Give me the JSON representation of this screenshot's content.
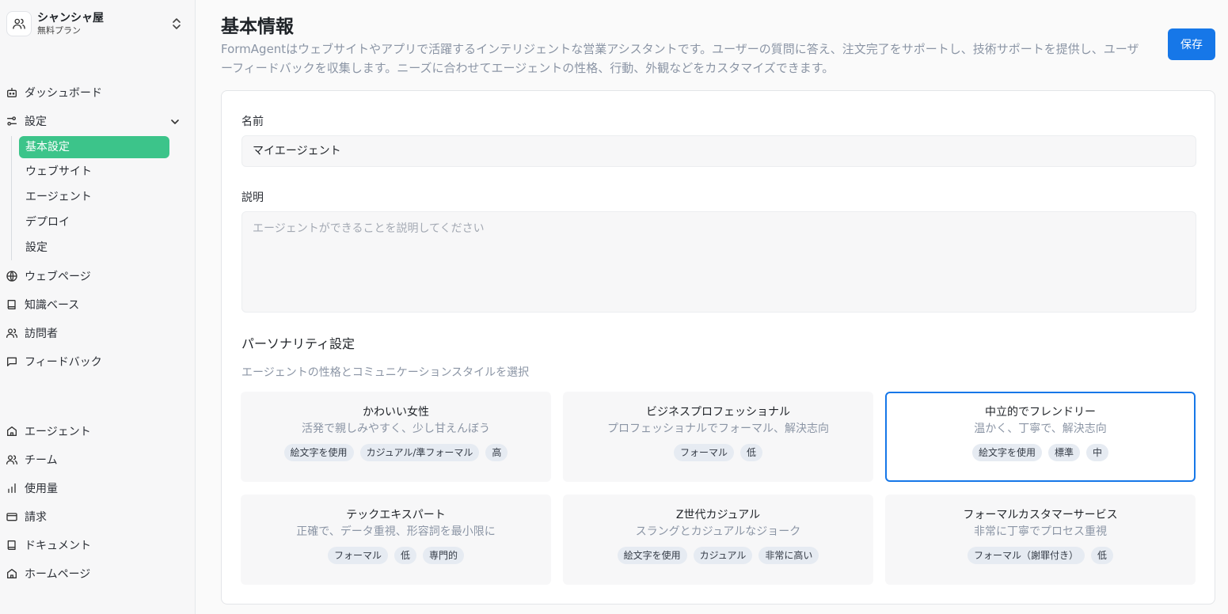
{
  "workspace": {
    "name": "シャンシャ屋",
    "plan": "無料プラン"
  },
  "nav_top": [
    {
      "label": "ダッシュボード",
      "icon": "robot-icon"
    },
    {
      "label": "設定",
      "icon": "settings-sliders-icon"
    }
  ],
  "settings_sub": [
    "基本設定",
    "ウェブサイト",
    "エージェント",
    "デプロイ",
    "設定"
  ],
  "nav_mid": [
    {
      "label": "ウェブページ",
      "icon": "globe-icon"
    },
    {
      "label": "知識ベース",
      "icon": "book-icon"
    },
    {
      "label": "訪問者",
      "icon": "users-icon"
    },
    {
      "label": "フィードバック",
      "icon": "message-square-icon"
    }
  ],
  "nav_bottom": [
    {
      "label": "エージェント",
      "icon": "home-icon"
    },
    {
      "label": "チーム",
      "icon": "users-icon"
    },
    {
      "label": "使用量",
      "icon": "bar-chart-icon"
    },
    {
      "label": "請求",
      "icon": "credit-card-icon"
    },
    {
      "label": "ドキュメント",
      "icon": "book-icon"
    },
    {
      "label": "ホームページ",
      "icon": "home-icon"
    }
  ],
  "header": {
    "title": "基本情報",
    "description": "FormAgentはウェブサイトやアプリで活躍するインテリジェントな営業アシスタントです。ユーザーの質問に答え、注文完了をサポートし、技術サポートを提供し、ユーザーフィードバックを収集します。ニーズに合わせてエージェントの性格、行動、外観などをカスタマイズできます。",
    "save_label": "保存"
  },
  "form": {
    "name_label": "名前",
    "name_value": "マイエージェント",
    "desc_label": "説明",
    "desc_placeholder": "エージェントができることを説明してください",
    "personality_title": "パーソナリティ設定",
    "personality_sub": "エージェントの性格とコミュニケーションスタイルを選択"
  },
  "personas": [
    {
      "title": "かわいい女性",
      "sub": "活発で親しみやすく、少し甘えんぼう",
      "tags": [
        "絵文字を使用",
        "カジュアル/準フォーマル",
        "高"
      ],
      "selected": false
    },
    {
      "title": "ビジネスプロフェッショナル",
      "sub": "プロフェッショナルでフォーマル、解決志向",
      "tags": [
        "フォーマル",
        "低"
      ],
      "selected": false
    },
    {
      "title": "中立的でフレンドリー",
      "sub": "温かく、丁寧で、解決志向",
      "tags": [
        "絵文字を使用",
        "標準",
        "中"
      ],
      "selected": true
    },
    {
      "title": "テックエキスパート",
      "sub": "正確で、データ重視、形容詞を最小限に",
      "tags": [
        "フォーマル",
        "低",
        "専門的"
      ],
      "selected": false
    },
    {
      "title": "Z世代カジュアル",
      "sub": "スラングとカジュアルなジョーク",
      "tags": [
        "絵文字を使用",
        "カジュアル",
        "非常に高い"
      ],
      "selected": false
    },
    {
      "title": "フォーマルカスタマーサービス",
      "sub": "非常に丁寧でプロセス重視",
      "tags": [
        "フォーマル（謝罪付き）",
        "低"
      ],
      "selected": false
    }
  ],
  "colors": {
    "accent": "#1677e8",
    "active_nav": "#3cc48a",
    "muted_text": "#8b95a5"
  }
}
